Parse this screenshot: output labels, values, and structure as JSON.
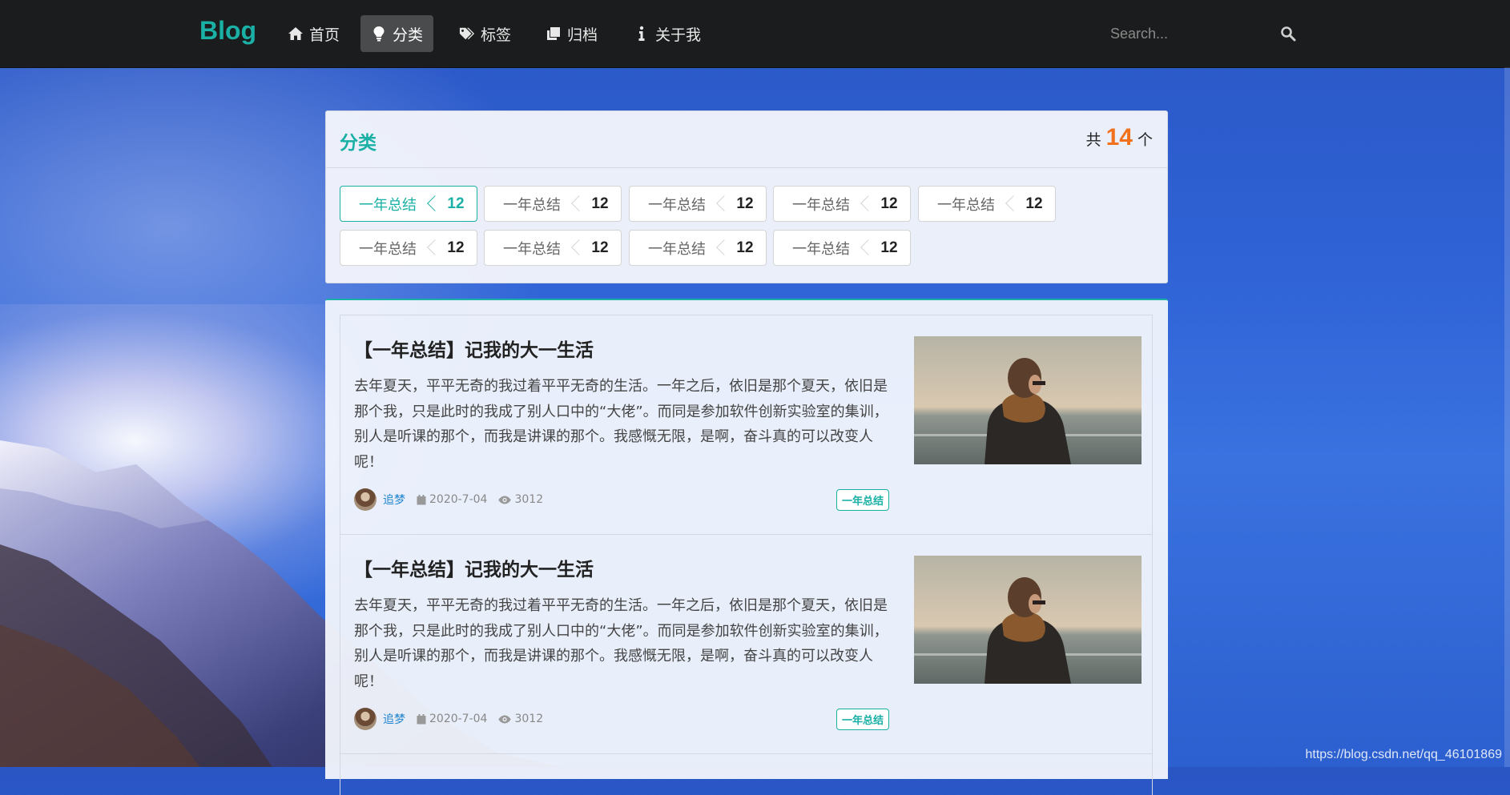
{
  "nav": {
    "brand": "Blog",
    "items": [
      {
        "label": "首页",
        "icon": "home-icon"
      },
      {
        "label": "分类",
        "icon": "lightbulb-icon",
        "active": true
      },
      {
        "label": "标签",
        "icon": "tags-icon"
      },
      {
        "label": "归档",
        "icon": "clone-icon"
      },
      {
        "label": "关于我",
        "icon": "info-icon"
      }
    ],
    "search_placeholder": "Search..."
  },
  "categories": {
    "title": "分类",
    "total_prefix": "共",
    "total": "14",
    "total_suffix": "个",
    "labels": [
      {
        "name": "一年总结",
        "count": "12",
        "active": true
      },
      {
        "name": "一年总结",
        "count": "12"
      },
      {
        "name": "一年总结",
        "count": "12"
      },
      {
        "name": "一年总结",
        "count": "12"
      },
      {
        "name": "一年总结",
        "count": "12"
      },
      {
        "name": "一年总结",
        "count": "12"
      },
      {
        "name": "一年总结",
        "count": "12"
      },
      {
        "name": "一年总结",
        "count": "12"
      },
      {
        "name": "一年总结",
        "count": "12"
      }
    ]
  },
  "posts": [
    {
      "title": "【一年总结】记我的大一生活",
      "excerpt": "去年夏天，平平无奇的我过着平平无奇的生活。一年之后，依旧是那个夏天，依旧是那个我，只是此时的我成了别人口中的“大佬”。而同是参加软件创新实验室的集训，别人是听课的那个，而我是讲课的那个。我感慨无限，是啊，奋斗真的可以改变人呢！",
      "author": "追梦",
      "date": "2020-7-04",
      "views": "3012",
      "tag": "一年总结"
    },
    {
      "title": "【一年总结】记我的大一生活",
      "excerpt": "去年夏天，平平无奇的我过着平平无奇的生活。一年之后，依旧是那个夏天，依旧是那个我，只是此时的我成了别人口中的“大佬”。而同是参加软件创新实验室的集训，别人是听课的那个，而我是讲课的那个。我感慨无限，是啊，奋斗真的可以改变人呢！",
      "author": "追梦",
      "date": "2020-7-04",
      "views": "3012",
      "tag": "一年总结"
    }
  ],
  "watermark": "https://blog.csdn.net/qq_46101869",
  "colors": {
    "accent": "#1ab0a5",
    "count_highlight": "#f2711c",
    "navbar": "#1b1c1d",
    "author_link": "#2185d0"
  }
}
